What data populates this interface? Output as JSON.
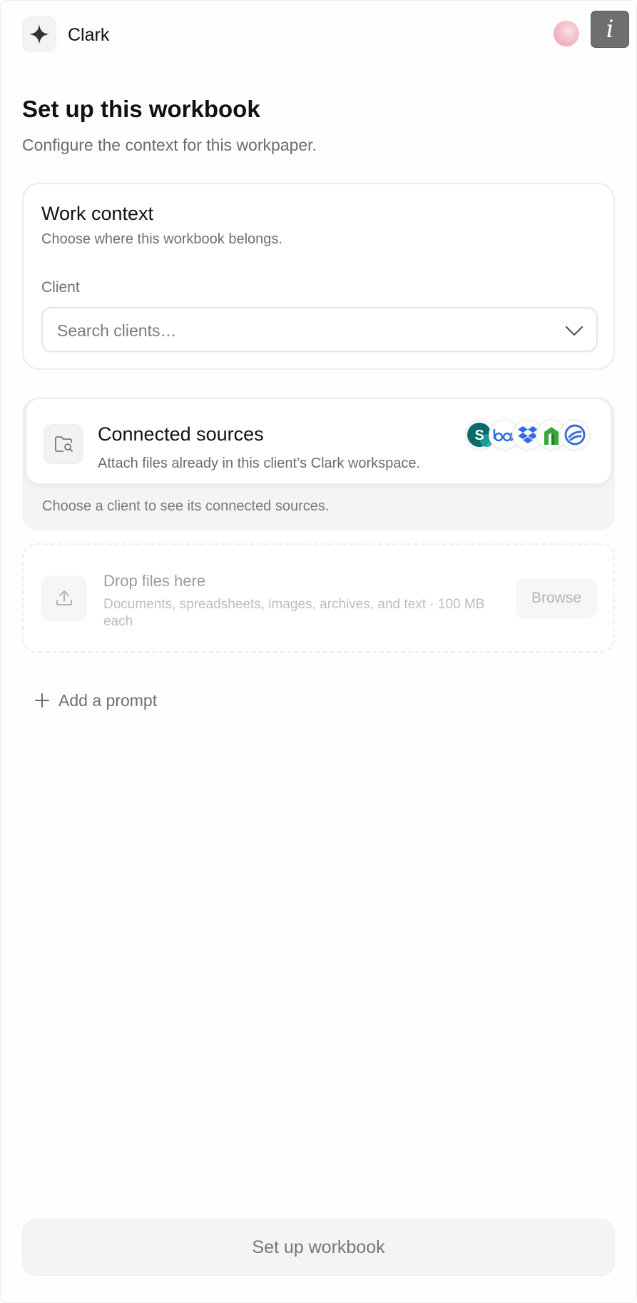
{
  "app": {
    "name": "Clark",
    "logo_icon": "sparkle-icon"
  },
  "header": {
    "info_label": "i",
    "avatar_color": "#f4b7c4"
  },
  "page": {
    "title": "Set up this workbook",
    "subtitle": "Configure the context for this workpaper."
  },
  "work_context": {
    "title": "Work context",
    "description": "Choose where this workbook belongs.",
    "client_label": "Client",
    "client_placeholder": "Search clients…"
  },
  "connected_sources": {
    "title": "Connected sources",
    "description": "Attach files already in this client’s Clark workspace.",
    "hint": "Choose a client to see its connected sources.",
    "providers": [
      {
        "name": "SharePoint",
        "icon": "sharepoint-icon"
      },
      {
        "name": "Box",
        "icon": "box-icon"
      },
      {
        "name": "Dropbox",
        "icon": "dropbox-icon"
      },
      {
        "name": "Egnyte",
        "icon": "egnyte-icon"
      },
      {
        "name": "ShareFile",
        "icon": "sharefile-icon"
      }
    ]
  },
  "dropzone": {
    "title": "Drop files here",
    "description": "Documents, spreadsheets, images, archives, and text · 100 MB each",
    "browse_label": "Browse"
  },
  "prompt": {
    "add_label": "Add a prompt"
  },
  "footer": {
    "submit_label": "Set up workbook"
  },
  "colors": {
    "accent_sharepoint": "#0b6a6a",
    "accent_box": "#2d6fd3",
    "accent_dropbox": "#2f6be6",
    "accent_egnyte": "#3aa83a",
    "accent_sharefile": "#3a6fd8"
  }
}
